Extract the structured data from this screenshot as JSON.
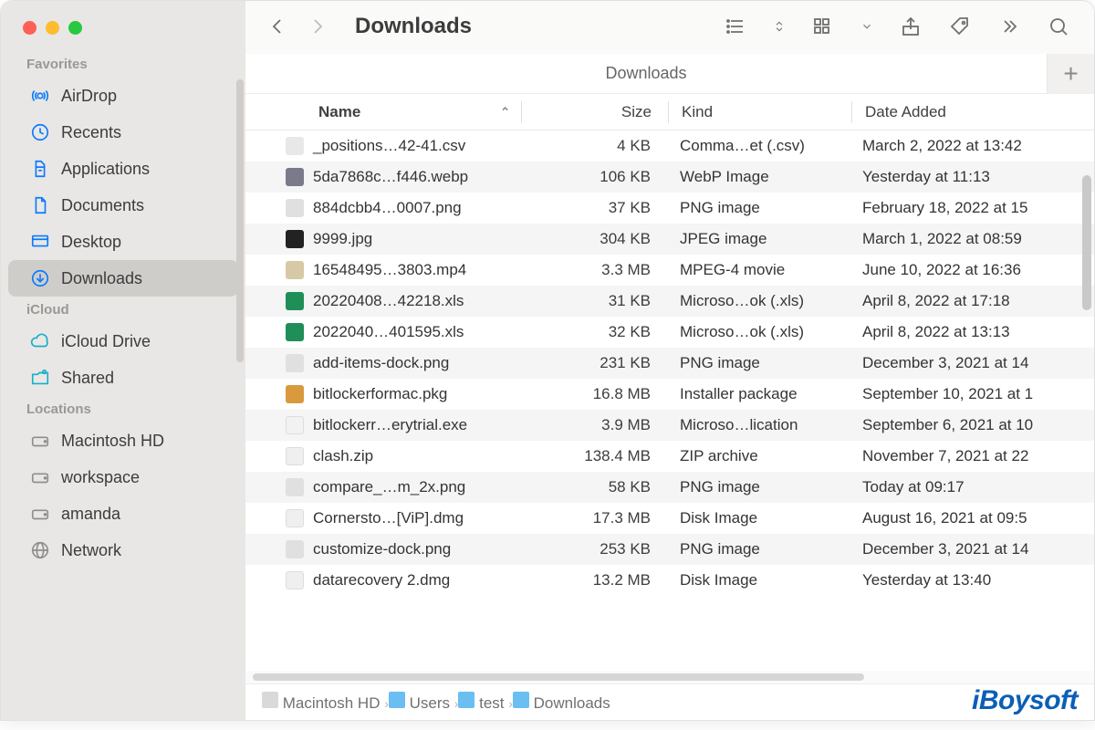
{
  "window": {
    "title": "Downloads",
    "subheader": "Downloads",
    "add_tab_label": "+"
  },
  "traffic": {
    "close": "close",
    "minimize": "minimize",
    "zoom": "zoom"
  },
  "sidebar": {
    "sections": [
      {
        "title": "Favorites",
        "items": [
          {
            "label": "AirDrop",
            "icon": "airdrop-icon",
            "color": "blue"
          },
          {
            "label": "Recents",
            "icon": "clock-icon",
            "color": "blue"
          },
          {
            "label": "Applications",
            "icon": "apps-icon",
            "color": "blue"
          },
          {
            "label": "Documents",
            "icon": "document-icon",
            "color": "blue"
          },
          {
            "label": "Desktop",
            "icon": "desktop-icon",
            "color": "blue"
          },
          {
            "label": "Downloads",
            "icon": "download-icon",
            "color": "blue",
            "selected": true
          }
        ]
      },
      {
        "title": "iCloud",
        "items": [
          {
            "label": "iCloud Drive",
            "icon": "cloud-icon",
            "color": "teal"
          },
          {
            "label": "Shared",
            "icon": "shared-folder-icon",
            "color": "teal"
          }
        ]
      },
      {
        "title": "Locations",
        "items": [
          {
            "label": "Macintosh HD",
            "icon": "disk-icon",
            "color": "gray"
          },
          {
            "label": "workspace",
            "icon": "disk-icon",
            "color": "gray"
          },
          {
            "label": "amanda",
            "icon": "disk-icon",
            "color": "gray"
          },
          {
            "label": "Network",
            "icon": "globe-icon",
            "color": "gray"
          }
        ]
      }
    ]
  },
  "columns": {
    "name": "Name",
    "size": "Size",
    "kind": "Kind",
    "date": "Date Added",
    "sort": "name_asc"
  },
  "files": [
    {
      "name": "_positions…42-41.csv",
      "size": "4 KB",
      "kind": "Comma…et (.csv)",
      "date": "March 2, 2022 at 13:42",
      "ic": "csv"
    },
    {
      "name": "5da7868c…f446.webp",
      "size": "106 KB",
      "kind": "WebP Image",
      "date": "Yesterday at 11:13",
      "ic": "webp"
    },
    {
      "name": "884dcbb4…0007.png",
      "size": "37 KB",
      "kind": "PNG image",
      "date": "February 18, 2022 at 15",
      "ic": "png"
    },
    {
      "name": "9999.jpg",
      "size": "304 KB",
      "kind": "JPEG image",
      "date": "March 1, 2022 at 08:59",
      "ic": "jpg"
    },
    {
      "name": "16548495…3803.mp4",
      "size": "3.3 MB",
      "kind": "MPEG-4 movie",
      "date": "June 10, 2022 at 16:36",
      "ic": "mp4"
    },
    {
      "name": "20220408…42218.xls",
      "size": "31 KB",
      "kind": "Microso…ok (.xls)",
      "date": "April 8, 2022 at 17:18",
      "ic": "xls"
    },
    {
      "name": "2022040…401595.xls",
      "size": "32 KB",
      "kind": "Microso…ok (.xls)",
      "date": "April 8, 2022 at 13:13",
      "ic": "xls"
    },
    {
      "name": "add-items-dock.png",
      "size": "231 KB",
      "kind": "PNG image",
      "date": "December 3, 2021 at 14",
      "ic": "png"
    },
    {
      "name": "bitlockerformac.pkg",
      "size": "16.8 MB",
      "kind": "Installer package",
      "date": "September 10, 2021 at 1",
      "ic": "pkg"
    },
    {
      "name": "bitlockerr…erytrial.exe",
      "size": "3.9 MB",
      "kind": "Microso…lication",
      "date": "September 6, 2021 at 10",
      "ic": "exe"
    },
    {
      "name": "clash.zip",
      "size": "138.4 MB",
      "kind": "ZIP archive",
      "date": "November 7, 2021 at 22",
      "ic": "zip"
    },
    {
      "name": "compare_…m_2x.png",
      "size": "58 KB",
      "kind": "PNG image",
      "date": "Today at 09:17",
      "ic": "png"
    },
    {
      "name": "Cornersto…[ViP].dmg",
      "size": "17.3 MB",
      "kind": "Disk Image",
      "date": "August 16, 2021 at 09:5",
      "ic": "dmg"
    },
    {
      "name": "customize-dock.png",
      "size": "253 KB",
      "kind": "PNG image",
      "date": "December 3, 2021 at 14",
      "ic": "png"
    },
    {
      "name": "datarecovery 2.dmg",
      "size": "13.2 MB",
      "kind": "Disk Image",
      "date": "Yesterday at 13:40",
      "ic": "dmg"
    }
  ],
  "path": {
    "segments": [
      {
        "label": "Macintosh HD",
        "icon": "disk"
      },
      {
        "label": "Users",
        "icon": "folder"
      },
      {
        "label": "test",
        "icon": "folder"
      },
      {
        "label": "Downloads",
        "icon": "folder"
      }
    ]
  },
  "watermark": "iBoysoft"
}
